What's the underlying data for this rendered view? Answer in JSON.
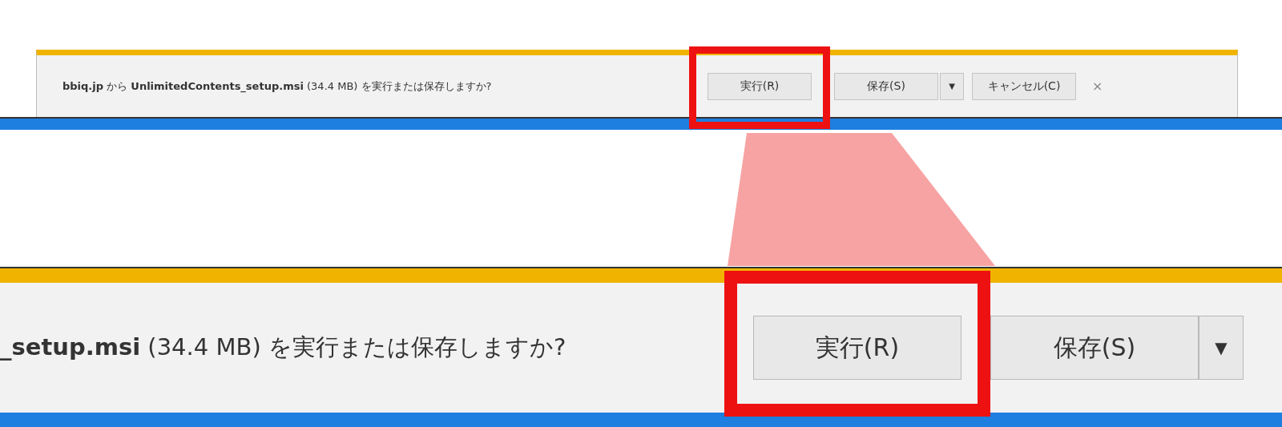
{
  "download_bar": {
    "message": "**bbiq.jp** から **UnlimitedContents_setup.msi** (34.4 MB) を実行または保存しますか?",
    "buttons": [
      {
        "kind": "button",
        "label": "実行(R)",
        "highlighted": true
      },
      {
        "kind": "button",
        "label": "保存(S)",
        "highlighted": false
      },
      {
        "kind": "arrow",
        "label": "▼",
        "highlighted": false
      },
      {
        "kind": "button",
        "label": "キャンセル(C)",
        "highlighted": false
      }
    ],
    "close": "×"
  },
  "zoomed_bar": {
    "message": "**_setup.msi** (34.4 MB) を実行または保存しますか?",
    "buttons": [
      {
        "kind": "button",
        "label": "実行(R)",
        "highlighted": true
      },
      {
        "kind": "button",
        "label": "保存(S)",
        "highlighted": false
      },
      {
        "kind": "arrow",
        "label": "▼",
        "highlighted": false
      }
    ]
  }
}
